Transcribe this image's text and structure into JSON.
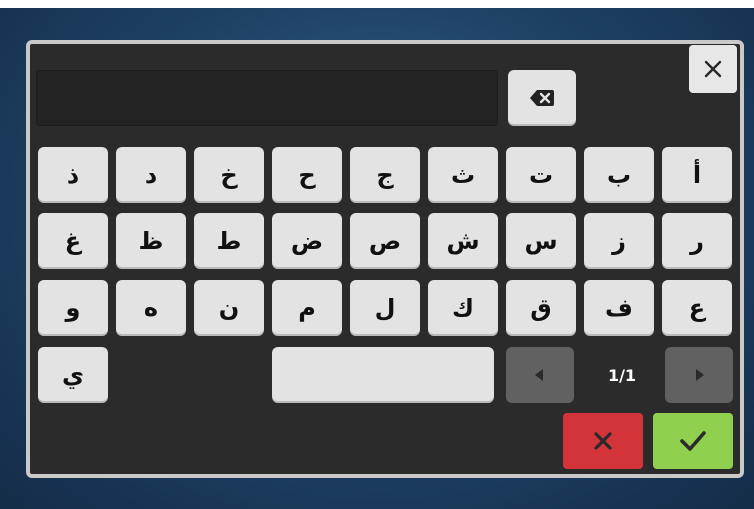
{
  "keyboard": {
    "rows": [
      [
        "ذ",
        "د",
        "خ",
        "ح",
        "ج",
        "ث",
        "ت",
        "ب",
        "أ"
      ],
      [
        "غ",
        "ظ",
        "ط",
        "ض",
        "ص",
        "ش",
        "س",
        "ز",
        "ر"
      ],
      [
        "و",
        "ه",
        "ن",
        "م",
        "ل",
        "ك",
        "ق",
        "ف",
        "ع"
      ],
      [
        "ي"
      ]
    ],
    "pager": {
      "page_label": "1/1"
    },
    "input_value": ""
  },
  "icons": {
    "close": "close-icon",
    "backspace": "backspace-icon",
    "prev": "chevron-left-icon",
    "next": "chevron-right-icon",
    "cancel": "x-icon",
    "confirm": "check-icon"
  },
  "colors": {
    "cancel": "#d2343a",
    "confirm": "#8fd14f",
    "panel": "#2b2b2b",
    "key": "#e3e3e3"
  }
}
